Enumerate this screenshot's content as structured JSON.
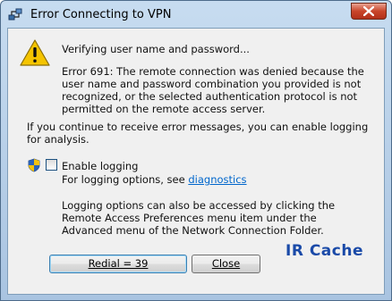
{
  "window": {
    "title": "Error Connecting to VPN"
  },
  "message": {
    "verifying": "Verifying user name and password...",
    "error": "Error 691: The remote connection was denied because the user name and password combination you provided is not recognized, or the selected authentication protocol is not permitted on the remote access server.",
    "continue_hint": "If you continue to receive error messages, you can enable logging for analysis."
  },
  "logging": {
    "checkbox_label": "Enable logging",
    "checked": false,
    "options_prefix": "For logging options, see ",
    "options_link": "diagnostics",
    "info": "Logging options can also be accessed by clicking the Remote Access Preferences menu item under the Advanced menu of the Network Connection Folder."
  },
  "buttons": {
    "redial": "Redial = 39",
    "close": "Close"
  },
  "watermark": "IR Cache",
  "icons": {
    "title": "vpn-network-icon",
    "warning": "warning-icon",
    "uac": "shield-icon",
    "close": "close-icon"
  },
  "colors": {
    "link": "#0066cc",
    "close_button": "#c9452a",
    "watermark": "#1a4aa8"
  }
}
